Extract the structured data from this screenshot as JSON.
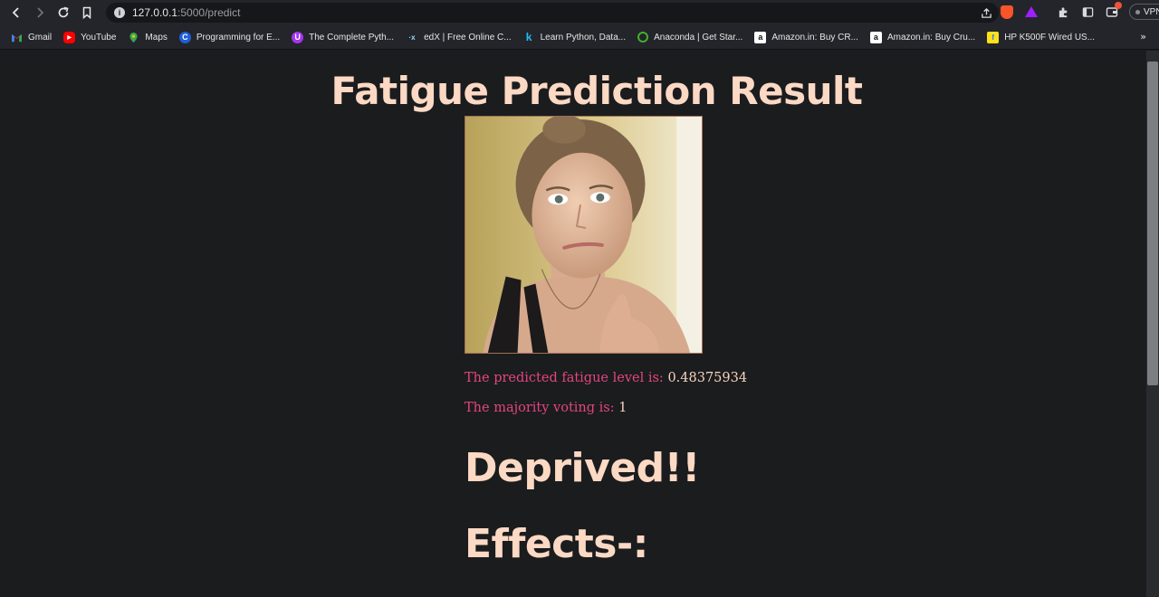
{
  "browser": {
    "url_host": "127.0.0.1",
    "url_path": ":5000/predict",
    "vpn_label": "VPN",
    "bookmarks": [
      {
        "label": "Gmail",
        "icon": "gmail-icon"
      },
      {
        "label": "YouTube",
        "icon": "youtube-icon"
      },
      {
        "label": "Maps",
        "icon": "maps-icon"
      },
      {
        "label": "Programming for E...",
        "icon": "course-c-icon"
      },
      {
        "label": "The Complete Pyth...",
        "icon": "udemy-icon"
      },
      {
        "label": "edX | Free Online C...",
        "icon": "edx-icon"
      },
      {
        "label": "Learn Python, Data...",
        "icon": "kaggle-icon"
      },
      {
        "label": "Anaconda | Get Star...",
        "icon": "anaconda-icon"
      },
      {
        "label": "Amazon.in: Buy CR...",
        "icon": "amazon-icon"
      },
      {
        "label": "Amazon.in: Buy Cru...",
        "icon": "amazon-icon"
      },
      {
        "label": "HP K500F Wired US...",
        "icon": "flipkart-icon"
      }
    ],
    "colors": {
      "toolbar": "#23252a",
      "brave": "#fb542b",
      "bat": "#9e1fff"
    }
  },
  "page": {
    "title": "Fatigue Prediction Result",
    "image_alt": "uploaded face photo",
    "fatigue_label": "The predicted fatigue level is:",
    "fatigue_value": "0.48375934",
    "voting_label": "The majority voting is:",
    "voting_value": "1",
    "status": "Deprived!!",
    "effects_heading": "Effects-:",
    "colors": {
      "background": "#1b1c1e",
      "heading": "#fbd9c4",
      "label": "#e5457e",
      "value": "#f8d4bf"
    }
  }
}
